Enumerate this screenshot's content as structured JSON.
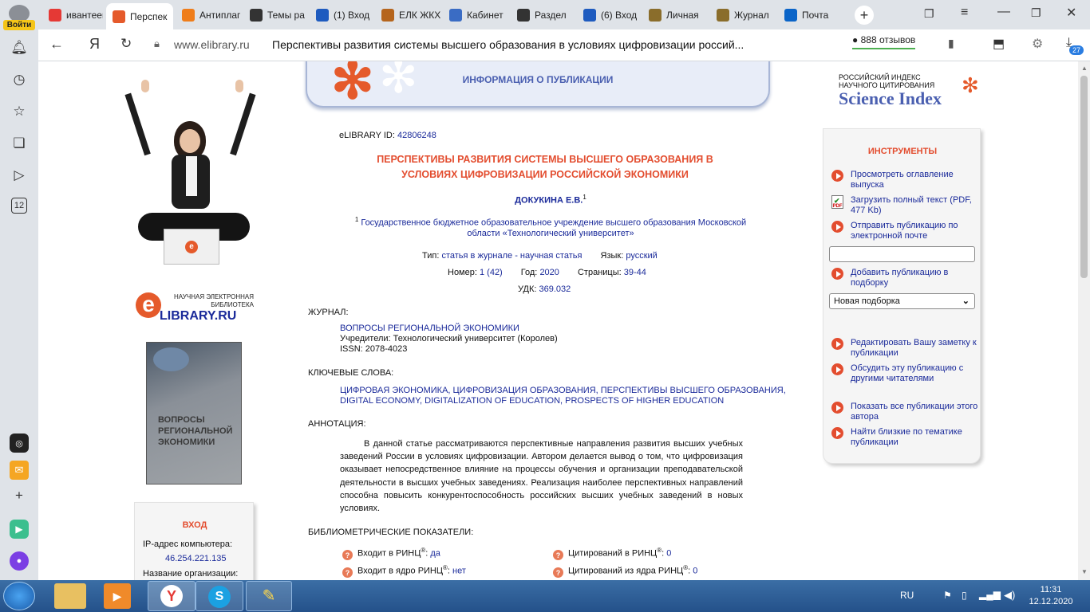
{
  "browser": {
    "login_label": "Войти",
    "tabs": [
      {
        "label": "ивантеев",
        "icon": "yandex-icon",
        "color": "#e53935",
        "active": false
      },
      {
        "label": "Перспек",
        "icon": "elibrary-icon",
        "color": "#e55a2b",
        "active": true
      },
      {
        "label": "Антиплаг",
        "icon": "antiplagiat-icon",
        "color": "#ef7d1a",
        "active": false
      },
      {
        "label": "Темы ра",
        "icon": "zen-icon",
        "color": "#333333",
        "active": false
      },
      {
        "label": "(1) Вход",
        "icon": "mail-icon",
        "color": "#1e5bbf",
        "active": false
      },
      {
        "label": "ЕЛК ЖКХ",
        "icon": "house-icon",
        "color": "#b5651d",
        "active": false
      },
      {
        "label": "Кабинет",
        "icon": "shield-icon",
        "color": "#3a6cc4",
        "active": false
      },
      {
        "label": "Раздел",
        "icon": "zen-icon",
        "color": "#333333",
        "active": false
      },
      {
        "label": "(6) Вход",
        "icon": "mail-icon",
        "color": "#1e5bbf",
        "active": false
      },
      {
        "label": "Личная",
        "icon": "bank-icon",
        "color": "#8a6d2b",
        "active": false
      },
      {
        "label": "Журнал",
        "icon": "bank-icon",
        "color": "#8a6d2b",
        "active": false
      },
      {
        "label": "Почта",
        "icon": "outlook-icon",
        "color": "#0a64c8",
        "active": false
      }
    ],
    "url_domain": "www.elibrary.ru",
    "page_title": "Перспективы развития системы высшего образования в условиях цифровизации россий...",
    "reviews": "888 отзывов",
    "downloads_badge": "27",
    "sidebar_badge": "12"
  },
  "left": {
    "logo_caption": "НАУЧНАЯ ЭЛЕКТРОННАЯ БИБЛИОТЕКА",
    "logo_text": "LIBRARY.RU",
    "cover_text": "ВОПРОСЫ РЕГИОНАЛЬНОЙ ЭКОНОМИКИ",
    "login_title": "ВХОД",
    "ip_label": "IP-адрес компьютера:",
    "ip_value": "46.254.221.135",
    "org_label": "Название организации:"
  },
  "main": {
    "header_title": "ИНФОРМАЦИЯ О ПУБЛИКАЦИИ",
    "elibrary_id_label": "eLIBRARY ID:",
    "elibrary_id": "42806248",
    "title_line1": "ПЕРСПЕКТИВЫ РАЗВИТИЯ СИСТЕМЫ ВЫСШЕГО ОБРАЗОВАНИЯ В",
    "title_line2": "УСЛОВИЯХ ЦИФРОВИЗАЦИИ РОССИЙСКОЙ ЭКОНОМИКИ",
    "author": "ДОКУКИНА Е.В.",
    "author_sup": "1",
    "affil_sup": "1",
    "affil_line1": "Государственное бюджетное образовательное учреждение высшего образования Московской",
    "affil_line2": "области «Технологический университет»",
    "type_label": "Тип:",
    "type_value": "статья в журнале - научная статья",
    "lang_label": "Язык:",
    "lang_value": "русский",
    "number_label": "Номер:",
    "number_value": "1 (42)",
    "year_label": "Год:",
    "year_value": "2020",
    "pages_label": "Страницы:",
    "pages_value": "39-44",
    "udk_label": "УДК:",
    "udk_value": "369.032",
    "journal_heading": "ЖУРНАЛ:",
    "journal_name": "ВОПРОСЫ РЕГИОНАЛЬНОЙ ЭКОНОМИКИ",
    "founder": "Учредители: Технологический университет (Королев)",
    "issn": "ISSN: 2078-4023",
    "keywords_heading": "КЛЮЧЕВЫЕ СЛОВА:",
    "keywords_line1": "ЦИФРОВАЯ ЭКОНОМИКА, ЦИФРОВИЗАЦИЯ ОБРАЗОВАНИЯ, ПЕРСПЕКТИВЫ ВЫСШЕГО ОБРАЗОВАНИЯ,",
    "keywords_line2": "DIGITAL ECONOMY, DIGITALIZATION OF EDUCATION, PROSPECTS OF HIGHER EDUCATION",
    "abstract_heading": "АННОТАЦИЯ:",
    "abstract_lines": [
      "В данной статье рассматриваются перспективные направления развития высших учебных",
      "заведений России в условиях цифровизации. Автором делается вывод о том, что цифровизация",
      "оказывает непосредственное влияние на процессы обучения и организации преподавательской",
      "деятельности в высших учебных заведениях. Реализация наиболее перспективных направлений",
      "способна повысить конкурентоспособность российских высших учебных заведений в новых",
      "условиях."
    ],
    "biblio_heading": "БИБЛИОМЕТРИЧЕСКИЕ ПОКАЗАТЕЛИ:",
    "metrics": [
      {
        "label": "Входит в РИНЦ",
        "value": "да"
      },
      {
        "label": "Цитирований в РИНЦ",
        "value": "0"
      },
      {
        "label": "Входит в ядро РИНЦ",
        "value": "нет"
      },
      {
        "label": "Цитирований из ядра РИНЦ",
        "value": "0"
      }
    ],
    "reg_mark": "®"
  },
  "right": {
    "si_line1": "РОССИЙСКИЙ ИНДЕКС",
    "si_line2": "НАУЧНОГО ЦИТИРОВАНИЯ",
    "si_title": "Science Index",
    "tools_title": "ИНСТРУМЕНТЫ",
    "tools": [
      {
        "l1": "Просмотреть оглавление",
        "l2": "выпуска"
      },
      {
        "l1": "Загрузить полный текст (PDF,",
        "l2": "477 Kb)"
      },
      {
        "l1": "Отправить публикацию по",
        "l2": "электронной почте"
      },
      {
        "l1": "Добавить публикацию в",
        "l2": "подборку"
      },
      {
        "l1": "Редактировать Вашу заметку к",
        "l2": "публикации"
      },
      {
        "l1": "Обсудить эту публикацию с",
        "l2": "другими читателями"
      },
      {
        "l1": "Показать все публикации этого",
        "l2": "автора"
      },
      {
        "l1": "Найти близкие по тематике",
        "l2": "публикации"
      }
    ],
    "collection_select": "Новая подборка"
  },
  "taskbar": {
    "lang": "RU",
    "time": "11:31",
    "date": "12.12.2020"
  },
  "colors": {
    "accent_red": "#e34d2f",
    "title_red": "#e34d2f",
    "link_blue": "#1a2a9a",
    "header_blue": "#4a5fb0"
  }
}
